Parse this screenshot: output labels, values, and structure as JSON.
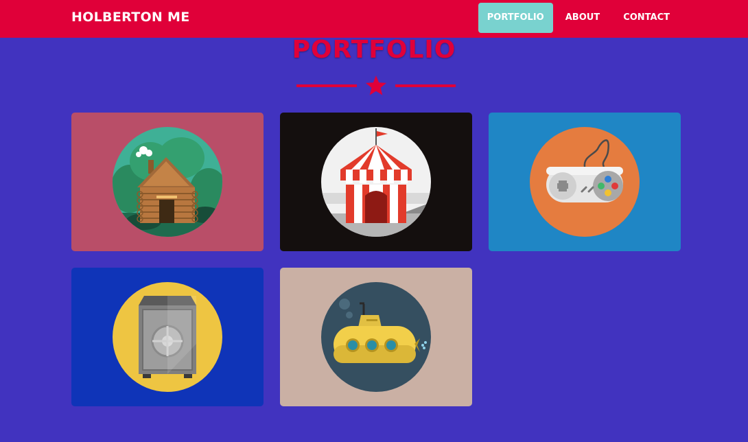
{
  "navbar": {
    "brand": "HOLBERTON ME",
    "items": [
      {
        "label": "PORTFOLIO",
        "active": true
      },
      {
        "label": "ABOUT",
        "active": false
      },
      {
        "label": "CONTACT",
        "active": false
      }
    ]
  },
  "portfolio": {
    "title": "PORTFOLIO",
    "divider_icon": "star-icon",
    "items": [
      {
        "icon": "cabin-icon",
        "background": "#b94e68"
      },
      {
        "icon": "circus-tent-icon",
        "background": "#140f0e"
      },
      {
        "icon": "game-controller-icon",
        "background": "#1f86c5"
      },
      {
        "icon": "safe-icon",
        "background": "#0f34b8"
      },
      {
        "icon": "submarine-icon",
        "background": "#cab0a4"
      }
    ]
  },
  "colors": {
    "page_background": "#4133bf",
    "navbar": "#e00039",
    "active_nav": "#79d2cf",
    "accent": "#e00039"
  }
}
